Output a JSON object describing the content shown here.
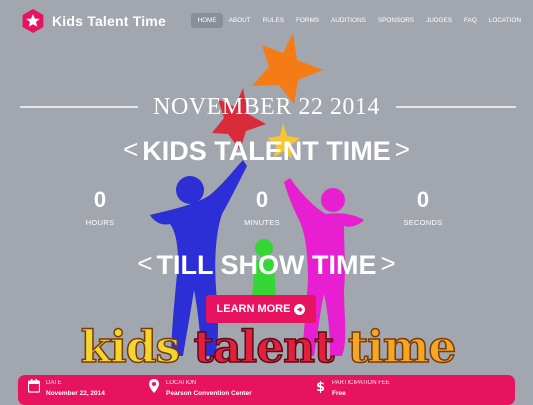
{
  "brand": {
    "name": "Kids Talent Time"
  },
  "nav": {
    "items": [
      "HOME",
      "ABOUT",
      "RULES",
      "FORMS",
      "AUDITIONS",
      "SPONSORS",
      "JUDGES",
      "FAQ",
      "LOCATION"
    ],
    "active": "HOME"
  },
  "hero": {
    "date": "NOVEMBER 22 2014",
    "title": "KIDS TALENT TIME",
    "subtitle": "TILL SHOW TIME",
    "cta_label": "LEARN MORE",
    "wordart": [
      "kids",
      "talent",
      "time"
    ]
  },
  "countdown": [
    {
      "value": "0",
      "label": "HOURS"
    },
    {
      "value": "0",
      "label": "MINUTES"
    },
    {
      "value": "0",
      "label": "SECONDS"
    }
  ],
  "info_bar": {
    "date": {
      "label": "DATE",
      "value": "November 22, 2014"
    },
    "location": {
      "label": "LOCATION",
      "value": "Pearson Convention Center"
    },
    "fee": {
      "label": "PARTICIPATION FEE",
      "value": "Free"
    }
  },
  "colors": {
    "accent": "#e8135f",
    "background": "#a2a6ae",
    "star_orange": "#f57c14",
    "star_red": "#d92b3a",
    "star_yellow": "#f7c531",
    "figure_blue": "#2c2fd6",
    "figure_magenta": "#e81fd0",
    "figure_green": "#37d637",
    "wordart_yellow": "#f3d52f",
    "wordart_red": "#e2203e",
    "wordart_orange": "#f5a623"
  },
  "icons": {
    "logo": "star-icon",
    "cta": "arrow-circle-right-icon",
    "date": "calendar-icon",
    "location": "map-pin-icon",
    "fee": "dollar-icon"
  }
}
